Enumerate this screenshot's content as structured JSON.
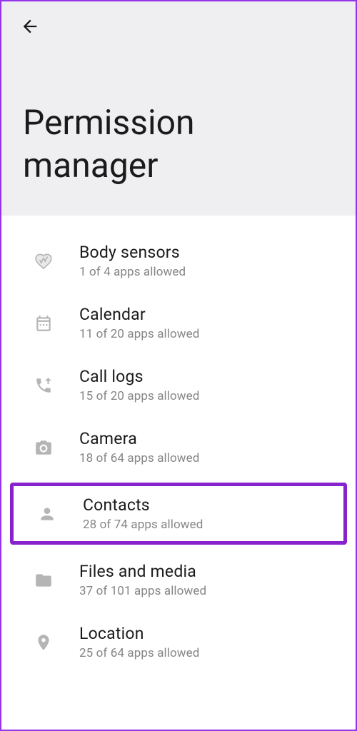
{
  "header": {
    "title": "Permission manager"
  },
  "items": [
    {
      "label": "Body sensors",
      "subtitle": "1 of 4 apps allowed",
      "highlighted": false
    },
    {
      "label": "Calendar",
      "subtitle": "11 of 20 apps allowed",
      "highlighted": false
    },
    {
      "label": "Call logs",
      "subtitle": "15 of 20 apps allowed",
      "highlighted": false
    },
    {
      "label": "Camera",
      "subtitle": "18 of 64 apps allowed",
      "highlighted": false
    },
    {
      "label": "Contacts",
      "subtitle": "28 of 74 apps allowed",
      "highlighted": true
    },
    {
      "label": "Files and media",
      "subtitle": "37 of 101 apps allowed",
      "highlighted": false
    },
    {
      "label": "Location",
      "subtitle": "25 of 64 apps allowed",
      "highlighted": false
    }
  ]
}
